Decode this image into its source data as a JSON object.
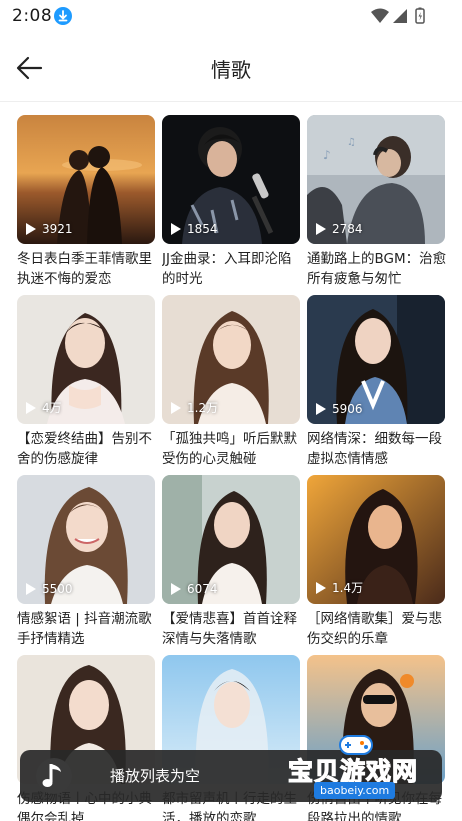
{
  "status": {
    "time": "2:08"
  },
  "header": {
    "title": "情歌"
  },
  "cards": [
    {
      "plays": "3921",
      "title": "冬日表白季王菲情歌里执迷不悔的爱恋"
    },
    {
      "plays": "1854",
      "title": "JJ金曲录：入耳即沦陷的时光"
    },
    {
      "plays": "2784",
      "title": "通勤路上的BGM：治愈所有疲惫与匆忙"
    },
    {
      "plays": "4万",
      "title": "【恋爱终结曲】告别不舍的伤感旋律"
    },
    {
      "plays": "1.2万",
      "title": "「孤独共鸣」听后默默受伤的心灵触碰"
    },
    {
      "plays": "5906",
      "title": "网络情深：细数每一段虚拟恋情情感"
    },
    {
      "plays": "5500",
      "title": "情感絮语 | 抖音潮流歌手抒情精选"
    },
    {
      "plays": "6074",
      "title": "【爱情悲喜】首首诠释深情与失落情歌"
    },
    {
      "plays": "1.4万",
      "title": "［网络情歌集］爱与悲伤交织的乐章"
    },
    {
      "plays": "",
      "title": "伤感物语丨心中的小典偶尔会乱掉"
    },
    {
      "plays": "",
      "title": "都市留声机丨行走的生活，播放的恋歌"
    },
    {
      "plays": "",
      "title": "伤情自由丨听见你在每段路拉出的情歌"
    }
  ],
  "player": {
    "text": "播放列表为空"
  },
  "watermark": {
    "text": "宝贝游戏网",
    "url": "baobeiy.com"
  },
  "colors": {
    "accent": "#1e9bff",
    "watermark": "#ff7a00",
    "player_bg": "#282828"
  }
}
